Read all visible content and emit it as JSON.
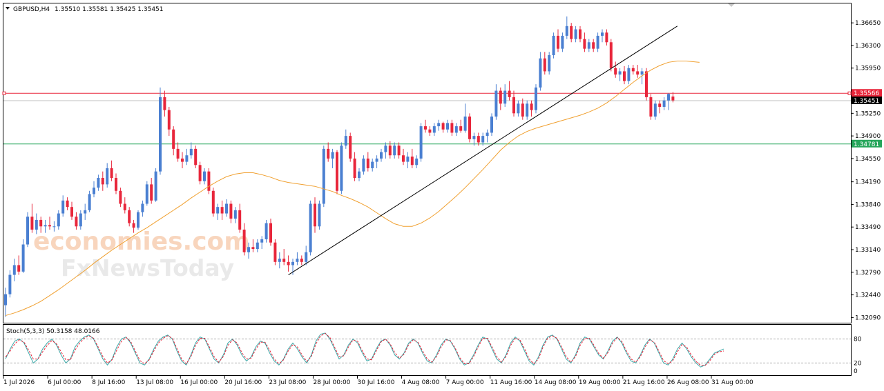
{
  "header": {
    "symbol": "GBPUSD,H4",
    "ohlc": "1.35510 1.35581 1.35425 1.35451",
    "dropdown_icon": "triangle-down-icon"
  },
  "watermark": {
    "line1": "economies.com",
    "line2": "FxNewsToday"
  },
  "price_axis": {
    "ticks": [
      "1.36650",
      "1.36300",
      "1.35950",
      "1.35250",
      "1.34900",
      "1.34550",
      "1.34190",
      "1.33840",
      "1.33490",
      "1.33140",
      "1.32790",
      "1.32440",
      "1.32090"
    ],
    "tick_values": [
      1.3665,
      1.363,
      1.3595,
      1.3525,
      1.349,
      1.3455,
      1.3419,
      1.3384,
      1.3349,
      1.3314,
      1.3279,
      1.3244,
      1.3209
    ]
  },
  "levels": {
    "resistance": {
      "value": 1.35566,
      "label": "1.35566",
      "color": "#e8263b"
    },
    "current": {
      "value": 1.35451,
      "label": "1.35451",
      "color": "#000000"
    },
    "support": {
      "value": 1.34781,
      "label": "1.34781",
      "color": "#26a65b"
    }
  },
  "time_axis": [
    "1 Jul 2026",
    "6 Jul 00:00",
    "8 Jul 16:00",
    "13 Jul 08:00",
    "16 Jul 00:00",
    "20 Jul 16:00",
    "23 Jul 08:00",
    "28 Jul 00:00",
    "30 Jul 16:00",
    "4 Aug 08:00",
    "7 Aug 00:00",
    "11 Aug 16:00",
    "14 Aug 08:00",
    "19 Aug 00:00",
    "21 Aug 16:00",
    "26 Aug 08:00",
    "31 Aug 00:00"
  ],
  "stoch": {
    "label": "Stoch(5,3,3) 50.3158 48.0166",
    "ticks": [
      "80",
      "20",
      "0"
    ],
    "tick_values": [
      80,
      20,
      0
    ]
  },
  "colors": {
    "bull": "#4a7fd1",
    "bear": "#e8263b",
    "ma": "#f0a030",
    "trend": "#000000",
    "main": "#3aa7a7",
    "signal": "#e8263b"
  },
  "chart_data": {
    "type": "candlestick",
    "ylim": [
      1.3203,
      1.3694
    ],
    "grid": false,
    "candles": [
      [
        1.3228,
        1.3255,
        1.321,
        1.3245
      ],
      [
        1.3245,
        1.3282,
        1.324,
        1.3275
      ],
      [
        1.3275,
        1.33,
        1.3265,
        1.329
      ],
      [
        1.329,
        1.3305,
        1.3275,
        1.328
      ],
      [
        1.328,
        1.333,
        1.3278,
        1.3322
      ],
      [
        1.3322,
        1.3372,
        1.3318,
        1.3365
      ],
      [
        1.3365,
        1.3385,
        1.334,
        1.3345
      ],
      [
        1.3345,
        1.337,
        1.3338,
        1.336
      ],
      [
        1.336,
        1.3365,
        1.334,
        1.335
      ],
      [
        1.335,
        1.336,
        1.334,
        1.3352
      ],
      [
        1.3352,
        1.3365,
        1.3345,
        1.335
      ],
      [
        1.335,
        1.3358,
        1.3342,
        1.335
      ],
      [
        1.335,
        1.3375,
        1.3345,
        1.337
      ],
      [
        1.337,
        1.3398,
        1.3365,
        1.339
      ],
      [
        1.339,
        1.3395,
        1.3375,
        1.338
      ],
      [
        1.338,
        1.3388,
        1.336,
        1.3365
      ],
      [
        1.3365,
        1.3372,
        1.3345,
        1.335
      ],
      [
        1.335,
        1.3375,
        1.3345,
        1.337
      ],
      [
        1.337,
        1.3385,
        1.336,
        1.3375
      ],
      [
        1.3375,
        1.3405,
        1.3372,
        1.34
      ],
      [
        1.34,
        1.342,
        1.3395,
        1.341
      ],
      [
        1.341,
        1.343,
        1.3405,
        1.3425
      ],
      [
        1.3425,
        1.3435,
        1.3405,
        1.3415
      ],
      [
        1.3415,
        1.3448,
        1.341,
        1.344
      ],
      [
        1.344,
        1.3452,
        1.342,
        1.3425
      ],
      [
        1.3425,
        1.3432,
        1.34,
        1.3405
      ],
      [
        1.3405,
        1.341,
        1.338,
        1.3385
      ],
      [
        1.3385,
        1.3395,
        1.337,
        1.3375
      ],
      [
        1.3375,
        1.338,
        1.335,
        1.3355
      ],
      [
        1.3355,
        1.336,
        1.334,
        1.3348
      ],
      [
        1.3348,
        1.3375,
        1.3345,
        1.3372
      ],
      [
        1.3372,
        1.339,
        1.3365,
        1.3385
      ],
      [
        1.3385,
        1.342,
        1.3382,
        1.3415
      ],
      [
        1.3415,
        1.3425,
        1.3385,
        1.339
      ],
      [
        1.339,
        1.344,
        1.3388,
        1.3435
      ],
      [
        1.3435,
        1.3565,
        1.343,
        1.355
      ],
      [
        1.355,
        1.356,
        1.352,
        1.353
      ],
      [
        1.353,
        1.3535,
        1.349,
        1.35
      ],
      [
        1.35,
        1.3505,
        1.346,
        1.347
      ],
      [
        1.347,
        1.348,
        1.345,
        1.3455
      ],
      [
        1.3455,
        1.3465,
        1.344,
        1.345
      ],
      [
        1.345,
        1.347,
        1.3445,
        1.346
      ],
      [
        1.346,
        1.348,
        1.3455,
        1.347
      ],
      [
        1.347,
        1.3475,
        1.344,
        1.3445
      ],
      [
        1.3445,
        1.345,
        1.3415,
        1.342
      ],
      [
        1.342,
        1.344,
        1.3415,
        1.3435
      ],
      [
        1.3435,
        1.344,
        1.34,
        1.3405
      ],
      [
        1.3405,
        1.341,
        1.3365,
        1.337
      ],
      [
        1.337,
        1.3385,
        1.336,
        1.338
      ],
      [
        1.338,
        1.339,
        1.336,
        1.337
      ],
      [
        1.337,
        1.3392,
        1.3365,
        1.3385
      ],
      [
        1.3385,
        1.339,
        1.3355,
        1.3362
      ],
      [
        1.3362,
        1.338,
        1.3355,
        1.3375
      ],
      [
        1.3375,
        1.3385,
        1.334,
        1.3345
      ],
      [
        1.3345,
        1.3355,
        1.3305,
        1.331
      ],
      [
        1.331,
        1.3325,
        1.33,
        1.3318
      ],
      [
        1.3318,
        1.333,
        1.331,
        1.3315
      ],
      [
        1.3315,
        1.333,
        1.331,
        1.3325
      ],
      [
        1.3325,
        1.3335,
        1.3315,
        1.333
      ],
      [
        1.333,
        1.336,
        1.3325,
        1.3355
      ],
      [
        1.3355,
        1.3362,
        1.332,
        1.3325
      ],
      [
        1.3325,
        1.333,
        1.329,
        1.3295
      ],
      [
        1.3295,
        1.331,
        1.3285,
        1.33
      ],
      [
        1.33,
        1.3315,
        1.329,
        1.3295
      ],
      [
        1.3295,
        1.3305,
        1.328,
        1.329
      ],
      [
        1.329,
        1.33,
        1.3275,
        1.3295
      ],
      [
        1.3295,
        1.331,
        1.329,
        1.33
      ],
      [
        1.33,
        1.3305,
        1.329,
        1.3295
      ],
      [
        1.3295,
        1.332,
        1.329,
        1.331
      ],
      [
        1.331,
        1.339,
        1.3305,
        1.3385
      ],
      [
        1.3385,
        1.3395,
        1.334,
        1.335
      ],
      [
        1.335,
        1.339,
        1.3345,
        1.3385
      ],
      [
        1.3385,
        1.3475,
        1.338,
        1.347
      ],
      [
        1.347,
        1.348,
        1.345,
        1.3455
      ],
      [
        1.3455,
        1.347,
        1.344,
        1.3465
      ],
      [
        1.3465,
        1.3468,
        1.34,
        1.3405
      ],
      [
        1.3405,
        1.348,
        1.34,
        1.3475
      ],
      [
        1.3475,
        1.35,
        1.347,
        1.349
      ],
      [
        1.349,
        1.3495,
        1.345,
        1.3455
      ],
      [
        1.3455,
        1.3465,
        1.342,
        1.3425
      ],
      [
        1.3425,
        1.344,
        1.342,
        1.3435
      ],
      [
        1.3435,
        1.346,
        1.343,
        1.3455
      ],
      [
        1.3455,
        1.3465,
        1.3435,
        1.344
      ],
      [
        1.344,
        1.3455,
        1.3435,
        1.345
      ],
      [
        1.345,
        1.346,
        1.344,
        1.3455
      ],
      [
        1.3455,
        1.347,
        1.345,
        1.3465
      ],
      [
        1.3465,
        1.348,
        1.3455,
        1.3475
      ],
      [
        1.3475,
        1.3482,
        1.3455,
        1.346
      ],
      [
        1.346,
        1.348,
        1.3455,
        1.3475
      ],
      [
        1.3475,
        1.348,
        1.3455,
        1.346
      ],
      [
        1.346,
        1.347,
        1.3445,
        1.345
      ],
      [
        1.345,
        1.3465,
        1.344,
        1.3458
      ],
      [
        1.3458,
        1.347,
        1.344,
        1.3445
      ],
      [
        1.3445,
        1.346,
        1.344,
        1.3455
      ],
      [
        1.3455,
        1.351,
        1.345,
        1.3505
      ],
      [
        1.3505,
        1.3515,
        1.3495,
        1.35
      ],
      [
        1.35,
        1.3505,
        1.349,
        1.3495
      ],
      [
        1.3495,
        1.351,
        1.349,
        1.3505
      ],
      [
        1.3505,
        1.3515,
        1.3498,
        1.351
      ],
      [
        1.351,
        1.3512,
        1.3495,
        1.35
      ],
      [
        1.35,
        1.3515,
        1.3495,
        1.351
      ],
      [
        1.351,
        1.3515,
        1.349,
        1.3495
      ],
      [
        1.3495,
        1.351,
        1.349,
        1.3505
      ],
      [
        1.3505,
        1.3515,
        1.3495,
        1.3498
      ],
      [
        1.3498,
        1.354,
        1.3495,
        1.352
      ],
      [
        1.352,
        1.3525,
        1.348,
        1.3485
      ],
      [
        1.3485,
        1.3495,
        1.3475,
        1.349
      ],
      [
        1.349,
        1.3495,
        1.3475,
        1.348
      ],
      [
        1.348,
        1.3495,
        1.3475,
        1.349
      ],
      [
        1.349,
        1.35,
        1.348,
        1.3495
      ],
      [
        1.3495,
        1.3525,
        1.349,
        1.352
      ],
      [
        1.352,
        1.357,
        1.3515,
        1.356
      ],
      [
        1.356,
        1.3565,
        1.353,
        1.354
      ],
      [
        1.354,
        1.357,
        1.3535,
        1.356
      ],
      [
        1.356,
        1.3575,
        1.3545,
        1.355
      ],
      [
        1.355,
        1.356,
        1.352,
        1.3525
      ],
      [
        1.3525,
        1.3545,
        1.352,
        1.354
      ],
      [
        1.354,
        1.3548,
        1.3515,
        1.352
      ],
      [
        1.352,
        1.3545,
        1.3515,
        1.354
      ],
      [
        1.354,
        1.3545,
        1.352,
        1.353
      ],
      [
        1.353,
        1.357,
        1.3525,
        1.3565
      ],
      [
        1.3565,
        1.362,
        1.356,
        1.361
      ],
      [
        1.361,
        1.362,
        1.3585,
        1.359
      ],
      [
        1.359,
        1.362,
        1.3585,
        1.3615
      ],
      [
        1.3615,
        1.365,
        1.361,
        1.3645
      ],
      [
        1.3645,
        1.3655,
        1.362,
        1.3625
      ],
      [
        1.3625,
        1.365,
        1.362,
        1.3645
      ],
      [
        1.3645,
        1.3675,
        1.364,
        1.366
      ],
      [
        1.366,
        1.3665,
        1.3635,
        1.364
      ],
      [
        1.364,
        1.366,
        1.3635,
        1.3655
      ],
      [
        1.3655,
        1.366,
        1.3635,
        1.364
      ],
      [
        1.364,
        1.365,
        1.362,
        1.3625
      ],
      [
        1.3625,
        1.364,
        1.362,
        1.3635
      ],
      [
        1.3635,
        1.364,
        1.362,
        1.3625
      ],
      [
        1.3625,
        1.365,
        1.362,
        1.3645
      ],
      [
        1.3645,
        1.3655,
        1.3635,
        1.365
      ],
      [
        1.365,
        1.3655,
        1.363,
        1.3635
      ],
      [
        1.3635,
        1.364,
        1.359,
        1.3595
      ],
      [
        1.3595,
        1.3605,
        1.358,
        1.3585
      ],
      [
        1.3585,
        1.3595,
        1.3575,
        1.359
      ],
      [
        1.359,
        1.3598,
        1.357,
        1.3575
      ],
      [
        1.3575,
        1.36,
        1.357,
        1.3595
      ],
      [
        1.3595,
        1.36,
        1.3585,
        1.359
      ],
      [
        1.359,
        1.36,
        1.358,
        1.3585
      ],
      [
        1.3585,
        1.3595,
        1.357,
        1.359
      ],
      [
        1.359,
        1.3595,
        1.3545,
        1.355
      ],
      [
        1.355,
        1.3555,
        1.3515,
        1.352
      ],
      [
        1.352,
        1.3545,
        1.3515,
        1.354
      ],
      [
        1.354,
        1.3545,
        1.3525,
        1.3535
      ],
      [
        1.3535,
        1.355,
        1.353,
        1.3545
      ],
      [
        1.3545,
        1.3556,
        1.353,
        1.3555
      ],
      [
        1.3551,
        1.3558,
        1.3542,
        1.3545
      ]
    ],
    "ma": [
      1.3212,
      1.3216,
      1.3221,
      1.3227,
      1.3234,
      1.3243,
      1.3252,
      1.3262,
      1.3272,
      1.3282,
      1.3293,
      1.3303,
      1.3313,
      1.3322,
      1.3331,
      1.334,
      1.3348,
      1.3357,
      1.3366,
      1.3375,
      1.3384,
      1.3394,
      1.3403,
      1.3412,
      1.342,
      1.3427,
      1.3431,
      1.3433,
      1.3433,
      1.343,
      1.3426,
      1.3421,
      1.3418,
      1.3416,
      1.3414,
      1.3412,
      1.3408,
      1.3404,
      1.3398,
      1.3393,
      1.3387,
      1.338,
      1.3371,
      1.3362,
      1.3354,
      1.335,
      1.335,
      1.3355,
      1.3363,
      1.3373,
      1.3385,
      1.3397,
      1.341,
      1.3424,
      1.3438,
      1.3453,
      1.3468,
      1.348,
      1.349,
      1.3497,
      1.3502,
      1.3506,
      1.351,
      1.3514,
      1.3518,
      1.3522,
      1.3527,
      1.3533,
      1.3541,
      1.3551,
      1.3562,
      1.3573,
      1.3583,
      1.3592,
      1.3599,
      1.3604,
      1.3606,
      1.3606,
      1.3604
    ],
    "ma_x": [
      0,
      2,
      4,
      6,
      8,
      10,
      12,
      14,
      16,
      18,
      20,
      22,
      24,
      26,
      28,
      30,
      32,
      34,
      36,
      38,
      40,
      42,
      44,
      46,
      48,
      50,
      52,
      54,
      56,
      58,
      60,
      62,
      64,
      66,
      68,
      70,
      72,
      74,
      76,
      78,
      80,
      82,
      84,
      86,
      88,
      90,
      92,
      94,
      96,
      98,
      100,
      102,
      104,
      106,
      108,
      110,
      112,
      114,
      116,
      118,
      120,
      122,
      124,
      126,
      128,
      130,
      132,
      134,
      136,
      138,
      140,
      142,
      144,
      146,
      148,
      150,
      152,
      154,
      157
    ],
    "trend_line": {
      "start": {
        "candle": 64,
        "price": 1.3275
      },
      "end": {
        "candle": 152,
        "price": 1.366
      }
    }
  },
  "stoch_data": {
    "main": [
      30,
      55,
      75,
      80,
      70,
      45,
      20,
      30,
      55,
      70,
      80,
      65,
      40,
      20,
      30,
      60,
      75,
      85,
      90,
      80,
      55,
      30,
      15,
      30,
      60,
      80,
      85,
      70,
      45,
      20,
      15,
      30,
      55,
      75,
      85,
      90,
      80,
      50,
      25,
      15,
      40,
      70,
      85,
      80,
      55,
      30,
      20,
      40,
      70,
      80,
      65,
      40,
      25,
      35,
      60,
      75,
      70,
      45,
      25,
      15,
      30,
      55,
      70,
      55,
      35,
      20,
      40,
      75,
      92,
      95,
      80,
      55,
      30,
      40,
      65,
      80,
      70,
      45,
      25,
      30,
      55,
      75,
      80,
      65,
      40,
      30,
      45,
      70,
      80,
      70,
      45,
      25,
      20,
      40,
      65,
      80,
      75,
      55,
      30,
      15,
      20,
      40,
      65,
      85,
      80,
      55,
      30,
      20,
      40,
      70,
      85,
      75,
      50,
      25,
      15,
      35,
      65,
      85,
      90,
      80,
      55,
      30,
      20,
      40,
      70,
      85,
      80,
      60,
      40,
      30,
      50,
      75,
      85,
      70,
      45,
      25,
      20,
      40,
      65,
      80,
      70,
      45,
      20,
      15,
      30,
      55,
      70,
      55,
      35,
      20,
      10,
      15,
      30,
      45,
      50,
      55
    ],
    "signal": [
      35,
      50,
      68,
      78,
      72,
      52,
      30,
      30,
      48,
      64,
      76,
      68,
      48,
      28,
      28,
      52,
      70,
      82,
      88,
      82,
      60,
      36,
      20,
      28,
      52,
      74,
      84,
      74,
      50,
      26,
      18,
      28,
      50,
      70,
      82,
      88,
      82,
      56,
      30,
      18,
      36,
      64,
      82,
      82,
      60,
      36,
      22,
      36,
      64,
      78,
      70,
      46,
      30,
      32,
      54,
      72,
      72,
      52,
      30,
      18,
      28,
      50,
      66,
      60,
      40,
      24,
      36,
      68,
      88,
      94,
      84,
      60,
      36,
      38,
      60,
      78,
      74,
      50,
      30,
      28,
      50,
      72,
      80,
      68,
      46,
      32,
      42,
      66,
      78,
      72,
      50,
      30,
      22,
      36,
      60,
      78,
      76,
      58,
      34,
      18,
      18,
      36,
      60,
      82,
      82,
      60,
      36,
      22,
      36,
      64,
      82,
      78,
      56,
      30,
      18,
      30,
      60,
      82,
      88,
      82,
      60,
      36,
      22,
      36,
      64,
      82,
      82,
      64,
      44,
      32,
      46,
      70,
      84,
      74,
      50,
      30,
      22,
      36,
      60,
      78,
      72,
      50,
      26,
      18,
      26,
      48,
      66,
      60,
      40,
      24,
      14,
      14,
      26,
      42,
      48,
      50
    ]
  }
}
